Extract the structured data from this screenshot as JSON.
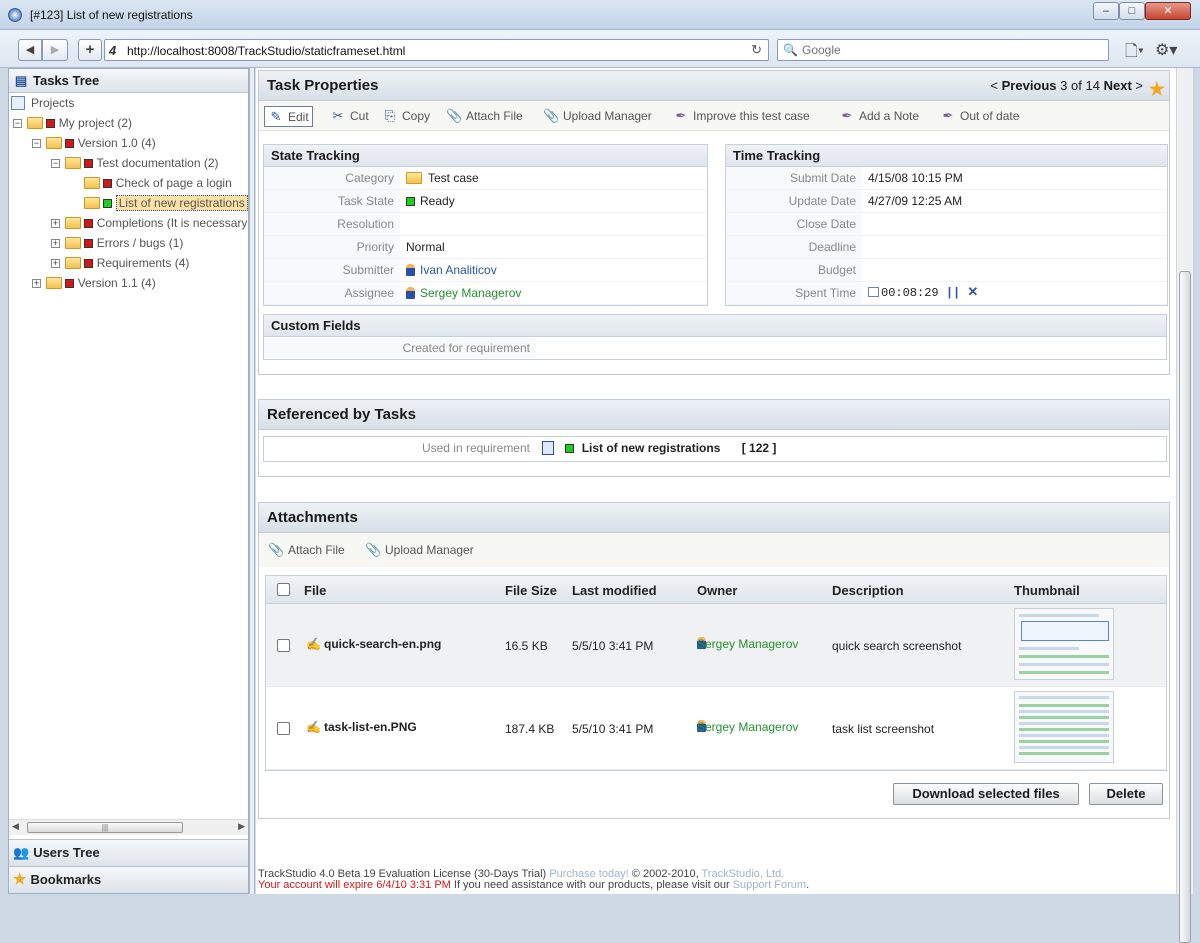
{
  "window": {
    "title": "[#123] List of new registrations"
  },
  "browser": {
    "url": "http://localhost:8008/TrackStudio/staticframeset.html",
    "search_placeholder": "Google"
  },
  "sidebar": {
    "header": "Tasks Tree",
    "tree": [
      {
        "label": "Projects",
        "level": 0,
        "type": "root"
      },
      {
        "label": "My project (2)",
        "level": 0,
        "type": "folder",
        "state": "red",
        "toggle": "−"
      },
      {
        "label": "Version 1.0 (4)",
        "level": 1,
        "type": "folder",
        "state": "red",
        "toggle": "−"
      },
      {
        "label": "Test documentation (2)",
        "level": 2,
        "type": "folder",
        "state": "red",
        "toggle": "−"
      },
      {
        "label": "Check of page a login",
        "level": 3,
        "type": "folder",
        "state": "red"
      },
      {
        "label": "List of new registrations",
        "level": 3,
        "type": "folder",
        "state": "green",
        "selected": true
      },
      {
        "label": "Completions (It is necessary",
        "level": 2,
        "type": "folder",
        "state": "red",
        "toggle": "+"
      },
      {
        "label": "Errors / bugs (1)",
        "level": 2,
        "type": "folder",
        "state": "red",
        "toggle": "+"
      },
      {
        "label": "Requirements (4)",
        "level": 2,
        "type": "folder",
        "state": "red",
        "toggle": "+"
      },
      {
        "label": "Version 1.1 (4)",
        "level": 1,
        "type": "folder",
        "state": "red",
        "toggle": "+"
      }
    ],
    "users_tree": "Users Tree",
    "bookmarks": "Bookmarks"
  },
  "task": {
    "header": "Task Properties",
    "nav": {
      "prev": "Previous",
      "current": "3",
      "of": "of",
      "total": "14",
      "next": "Next"
    },
    "toolbar": [
      "Edit",
      "Cut",
      "Copy",
      "Attach File",
      "Upload Manager",
      "Improve this test case",
      "Add a Note",
      "Out of date"
    ],
    "state_tracking": {
      "title": "State Tracking",
      "rows": [
        {
          "label": "Category",
          "value": "Test case",
          "icon": "folder"
        },
        {
          "label": "Task State",
          "value": "Ready",
          "icon": "green"
        },
        {
          "label": "Resolution",
          "value": ""
        },
        {
          "label": "Priority",
          "value": "Normal"
        },
        {
          "label": "Submitter",
          "value": "Ivan Analiticov",
          "icon": "user",
          "style": "link"
        },
        {
          "label": "Assignee",
          "value": "Sergey Managerov",
          "icon": "user",
          "style": "glink"
        }
      ]
    },
    "time_tracking": {
      "title": "Time Tracking",
      "rows": [
        {
          "label": "Submit Date",
          "value": "4/15/08 10:15 PM"
        },
        {
          "label": "Update Date",
          "value": "4/27/09 12:25 AM"
        },
        {
          "label": "Close Date",
          "value": ""
        },
        {
          "label": "Deadline",
          "value": ""
        },
        {
          "label": "Budget",
          "value": ""
        },
        {
          "label": "Spent Time",
          "value": "00:08:29",
          "icon": "timer"
        }
      ]
    },
    "custom_fields": {
      "title": "Custom Fields",
      "label": "Created for requirement",
      "value": ""
    }
  },
  "referenced": {
    "header": "Referenced by Tasks",
    "label": "Used in requirement",
    "task": "List of new registrations",
    "number": "[ 122 ]"
  },
  "attachments": {
    "header": "Attachments",
    "toolbar": [
      "Attach File",
      "Upload Manager"
    ],
    "columns": [
      "File",
      "File Size",
      "Last modified",
      "Owner",
      "Description",
      "Thumbnail"
    ],
    "rows": [
      {
        "file": "quick-search-en.png",
        "size": "16.5 KB",
        "modified": "5/5/10 3:41 PM",
        "owner": "Sergey Managerov",
        "description": "quick search screenshot"
      },
      {
        "file": "task-list-en.PNG",
        "size": "187.4 KB",
        "modified": "5/5/10 3:41 PM",
        "owner": "Sergey Managerov",
        "description": "task list screenshot"
      }
    ],
    "download_label": "Download selected files",
    "delete_label": "Delete"
  },
  "footer": {
    "line1_a": "TrackStudio 4.0 Beta 19 Evaluation License (30-Days Trial) ",
    "line1_link": "Purchase today!",
    "line1_b": " © 2002-2010,  ",
    "line1_link2": "TrackStudio, Ltd.",
    "line2_red": "Your account will expire 6/4/10 3:31 PM",
    "line2_b": " If you need assistance with our products, please visit our ",
    "line2_link": "Support Forum",
    "line2_c": "."
  },
  "colors": {
    "accent": "#2a56a0",
    "state_red": "#d21717",
    "state_green": "#17d217",
    "owner_green": "#23922f"
  }
}
